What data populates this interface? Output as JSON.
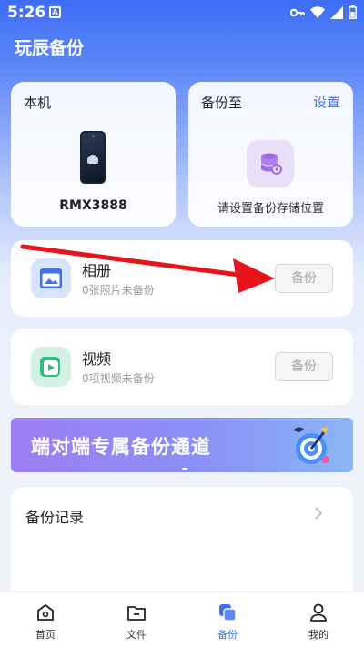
{
  "status": {
    "time": "5:26",
    "notif": "A"
  },
  "header": {
    "title": "玩辰备份"
  },
  "local_card": {
    "label": "本机",
    "device": "RMX3888"
  },
  "backup_card": {
    "label": "备份至",
    "settings": "设置",
    "hint": "请设置备份存储位置"
  },
  "items": [
    {
      "title": "相册",
      "sub": "0张照片未备份",
      "button": "备份"
    },
    {
      "title": "视频",
      "sub": "0项视频未备份",
      "button": "备份"
    }
  ],
  "banner": {
    "text": "端对端专属备份通道"
  },
  "records": {
    "title": "备份记录"
  },
  "nav": [
    {
      "label": "首页",
      "icon": "home-icon"
    },
    {
      "label": "文件",
      "icon": "folder-icon"
    },
    {
      "label": "备份",
      "icon": "backup-icon",
      "active": true
    },
    {
      "label": "我的",
      "icon": "user-icon"
    }
  ],
  "colors": {
    "accent": "#3e6ff5",
    "arrow": "#e8141c"
  }
}
